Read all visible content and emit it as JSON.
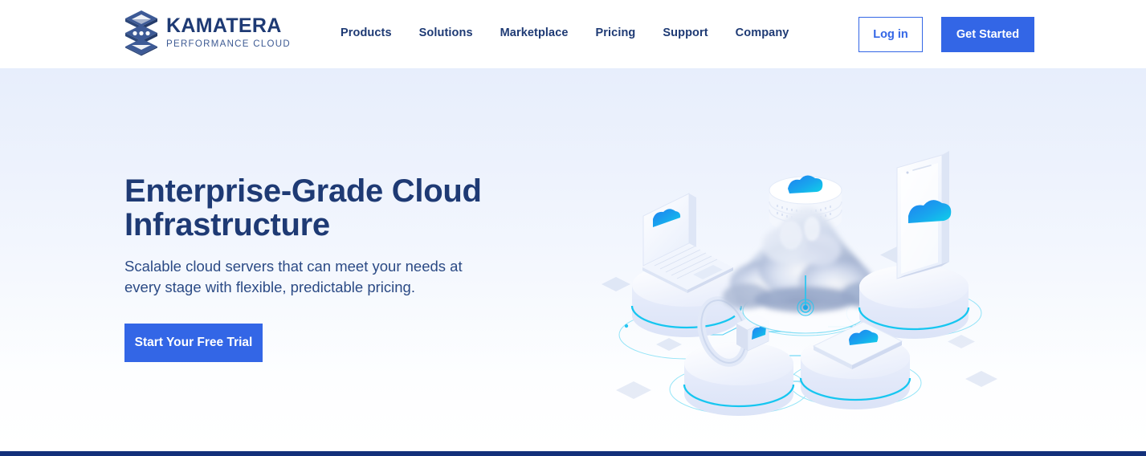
{
  "brand": {
    "name": "KAMATERA",
    "tagline": "PERFORMANCE CLOUD",
    "logo_icon": "stacked-hexagon-layers-icon",
    "navy": "#1e3a74",
    "accent_blue": "#3366e6",
    "cyan": "#12b5ea"
  },
  "header": {
    "nav": [
      {
        "label": "Products"
      },
      {
        "label": "Solutions"
      },
      {
        "label": "Marketplace"
      },
      {
        "label": "Pricing"
      },
      {
        "label": "Support"
      },
      {
        "label": "Company"
      }
    ],
    "login_label": "Log in",
    "get_started_label": "Get Started"
  },
  "hero": {
    "title": "Enterprise-Grade Cloud Infrastructure",
    "subtitle": "Scalable cloud servers that can meet your needs at every stage with flexible, predictable pricing.",
    "cta_label": "Start Your Free Trial",
    "illustration": {
      "name": "isometric-cloud-infrastructure-illustration",
      "center": "cloud-server-cylinder-with-cloud-icon",
      "devices": [
        "laptop-on-pedestal",
        "tablet-phone-on-pedestal",
        "smartwatch-on-pedestal",
        "tablet-flat-on-pedestal"
      ],
      "background_gradient_top": "#e7eefc",
      "background_gradient_bottom": "#ffffff"
    }
  },
  "footer_band": {
    "color": "#13307a"
  }
}
